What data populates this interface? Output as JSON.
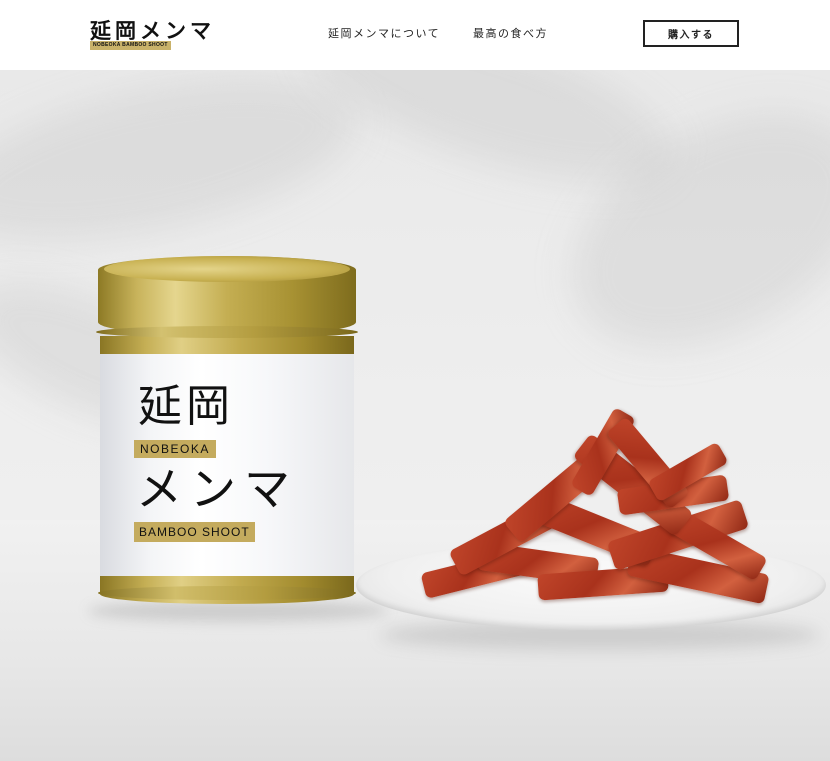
{
  "header": {
    "logo_main": "延岡メンマ",
    "logo_sub": "NOBEOKA BAMBOO SHOOT",
    "nav": [
      {
        "label": "延岡メンマについて"
      },
      {
        "label": "最高の食べ方"
      }
    ],
    "buy_label": "購入する"
  },
  "hero": {
    "can_label": {
      "line1": "延岡",
      "tag1": "NOBEOKA",
      "line2": "メンマ",
      "tag2": "BAMBOO SHOOT"
    }
  },
  "colors": {
    "accent_gold": "#c4ab5e",
    "text_dark": "#111111",
    "background": "#ffffff",
    "menma_red": "#b23a20"
  }
}
